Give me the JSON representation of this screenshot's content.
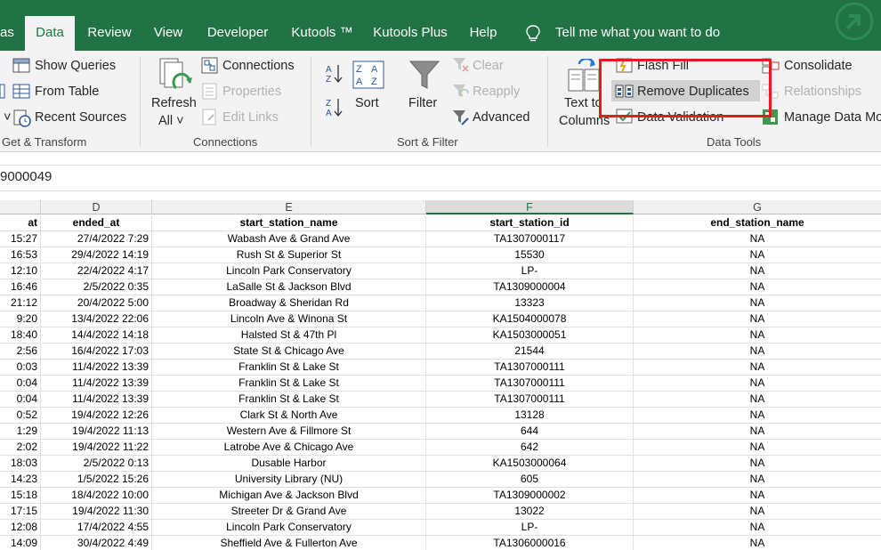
{
  "tabs": [
    "as",
    "Data",
    "Review",
    "View",
    "Developer",
    "Kutools ™",
    "Kutools Plus",
    "Help"
  ],
  "active_tab": "Data",
  "tell_me": "Tell me what you want to do",
  "ribbon": {
    "get_transform": {
      "show_queries": "Show Queries",
      "from_table": "From Table",
      "recent_sources": "Recent Sources",
      "label": "Get & Transform"
    },
    "connections": {
      "refresh_all_1": "Refresh",
      "refresh_all_2": "All ˅",
      "connections": "Connections",
      "properties": "Properties",
      "edit_links": "Edit Links",
      "label": "Connections"
    },
    "sort_filter": {
      "sort": "Sort",
      "filter": "Filter",
      "clear": "Clear",
      "reapply": "Reapply",
      "advanced": "Advanced",
      "label": "Sort & Filter"
    },
    "data_tools": {
      "text_to_columns_1": "Text to",
      "text_to_columns_2": "Columns",
      "flash_fill": "Flash Fill",
      "remove_duplicates": "Remove Duplicates",
      "data_validation": "Data Validation",
      "consolidate": "Consolidate",
      "relationships": "Relationships",
      "manage_data_model": "Manage Data Mo",
      "label": "Data Tools"
    }
  },
  "formula_bar": {
    "value": "9000049"
  },
  "columns": [
    "D",
    "E",
    "F",
    "G"
  ],
  "header_row": [
    "at",
    "ended_at",
    "start_station_name",
    "start_station_id",
    "end_station_name"
  ],
  "rows": [
    [
      "15:27",
      "27/4/2022 7:29",
      "Wabash Ave & Grand Ave",
      "TA1307000117",
      "NA"
    ],
    [
      "16:53",
      "29/4/2022 14:19",
      "Rush St & Superior St",
      "15530",
      "NA"
    ],
    [
      "12:10",
      "22/4/2022 4:17",
      "Lincoln Park Conservatory",
      "LP-",
      "NA"
    ],
    [
      "16:46",
      "2/5/2022 0:35",
      "LaSalle St & Jackson Blvd",
      "TA1309000004",
      "NA"
    ],
    [
      "21:12",
      "20/4/2022 5:00",
      "Broadway & Sheridan Rd",
      "13323",
      "NA"
    ],
    [
      "9:20",
      "13/4/2022 22:06",
      "Lincoln Ave & Winona St",
      "KA1504000078",
      "NA"
    ],
    [
      "18:40",
      "14/4/2022 14:18",
      "Halsted St & 47th Pl",
      "KA1503000051",
      "NA"
    ],
    [
      "2:56",
      "16/4/2022 17:03",
      "State St & Chicago Ave",
      "21544",
      "NA"
    ],
    [
      "0:03",
      "11/4/2022 13:39",
      "Franklin St & Lake St",
      "TA1307000111",
      "NA"
    ],
    [
      "0:04",
      "11/4/2022 13:39",
      "Franklin St & Lake St",
      "TA1307000111",
      "NA"
    ],
    [
      "0:04",
      "11/4/2022 13:39",
      "Franklin St & Lake St",
      "TA1307000111",
      "NA"
    ],
    [
      "0:52",
      "19/4/2022 12:26",
      "Clark St & North Ave",
      "13128",
      "NA"
    ],
    [
      "1:29",
      "19/4/2022 11:13",
      "Western Ave & Fillmore St",
      "644",
      "NA"
    ],
    [
      "2:02",
      "19/4/2022 11:22",
      "Latrobe Ave & Chicago Ave",
      "642",
      "NA"
    ],
    [
      "18:03",
      "2/5/2022 0:13",
      "Dusable Harbor",
      "KA1503000064",
      "NA"
    ],
    [
      "14:23",
      "1/5/2022 15:26",
      "University Library (NU)",
      "605",
      "NA"
    ],
    [
      "15:18",
      "18/4/2022 10:00",
      "Michigan Ave & Jackson Blvd",
      "TA1309000002",
      "NA"
    ],
    [
      "17:15",
      "19/4/2022 11:30",
      "Streeter Dr & Grand Ave",
      "13022",
      "NA"
    ],
    [
      "12:08",
      "17/4/2022 4:55",
      "Lincoln Park Conservatory",
      "LP-",
      "NA"
    ],
    [
      "14:09",
      "30/4/2022 4:49",
      "Sheffield Ave & Fullerton Ave",
      "TA1306000016",
      "NA"
    ]
  ],
  "colors": {
    "excel_green": "#217346",
    "highlight_red": "#e31b23"
  }
}
